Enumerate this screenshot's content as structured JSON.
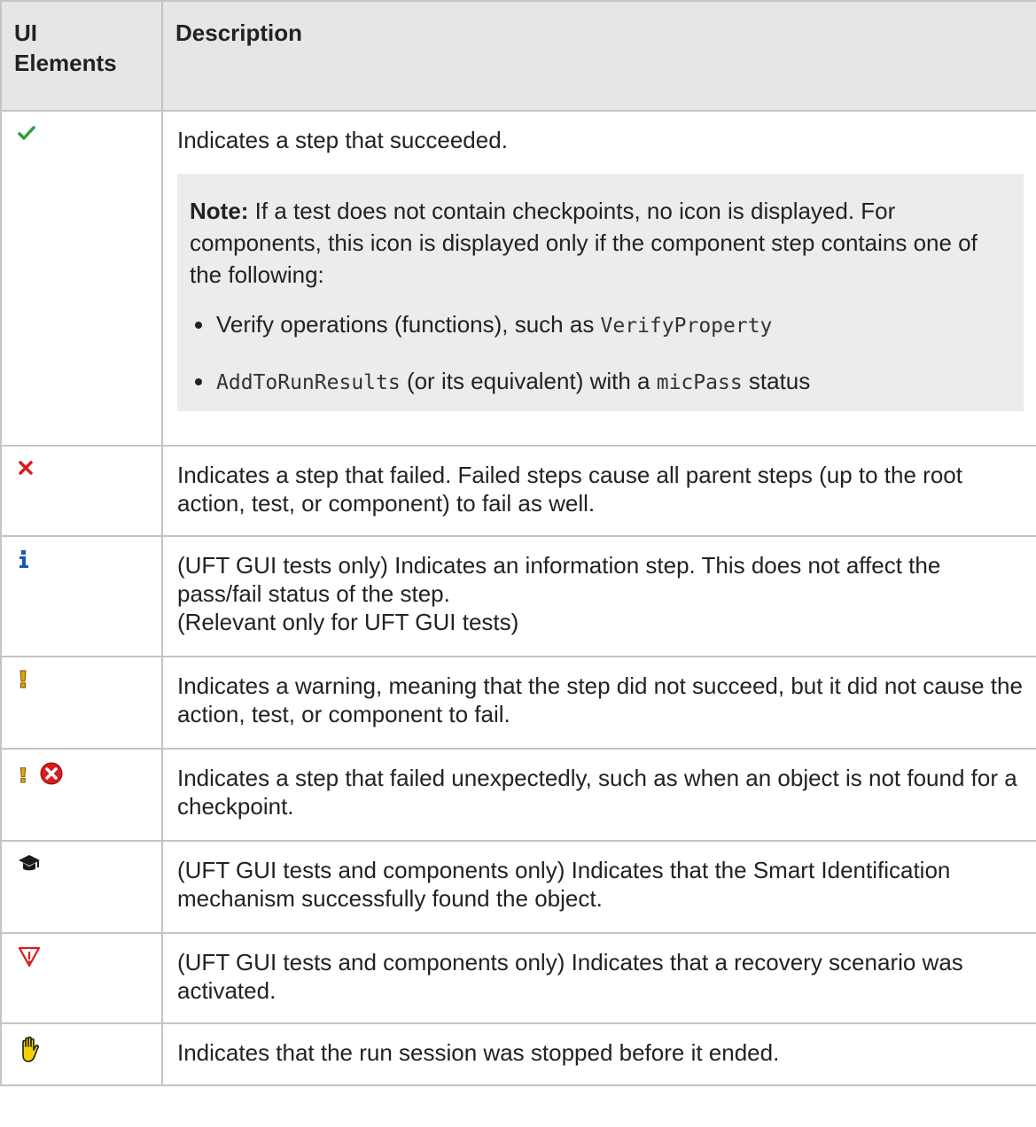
{
  "header": {
    "col1_line1": "UI",
    "col1_line2": "Elements",
    "col2": "Description"
  },
  "rows": [
    {
      "icon": "check-icon",
      "description": "Indicates a step that succeeded.",
      "note": {
        "label": "Note:",
        "text": " If a test does not contain checkpoints, no icon is displayed. For components, this icon is displayed only if the component step contains one of the following:",
        "bullets": [
          {
            "pre": "Verify operations (functions), such as ",
            "code": "VerifyProperty"
          },
          {
            "code1": "AddToRunResults",
            "mid": " (or its equivalent) with a ",
            "code2": "micPass",
            "post": " status"
          }
        ]
      }
    },
    {
      "icon": "x-mark-icon",
      "description": "Indicates a step that failed. Failed steps cause all parent steps (up to the root action, test, or component) to fail as well."
    },
    {
      "icon": "info-icon",
      "description_line1": "(UFT GUI tests only) Indicates an information step. This does not affect the pass/fail status of the step.",
      "description_line2": "(Relevant only for UFT GUI tests)"
    },
    {
      "icon": "warning-exclamation-icon",
      "description": "Indicates a warning, meaning that the step did not succeed, but it did not cause the action, test, or component to fail."
    },
    {
      "icon": "unexpected-failure-icon",
      "description": "Indicates a step that failed unexpectedly, such as when an object is not found for a checkpoint."
    },
    {
      "icon": "graduation-cap-icon",
      "description": "(UFT GUI tests and components only) Indicates that the Smart Identification mechanism successfully found the object."
    },
    {
      "icon": "recovery-triangle-icon",
      "description": "(UFT GUI tests and components only) Indicates that a recovery scenario was activated."
    },
    {
      "icon": "stop-hand-icon",
      "description": "Indicates that the run session was stopped before it ended."
    }
  ],
  "colors": {
    "header_bg": "#e6e6e6",
    "note_bg": "#ececec",
    "border": "#c4c4c4",
    "check_green": "#2e9e3a",
    "fail_red": "#d91c1c",
    "info_blue": "#1a56b8",
    "warning_yellow": "#e0a800"
  }
}
